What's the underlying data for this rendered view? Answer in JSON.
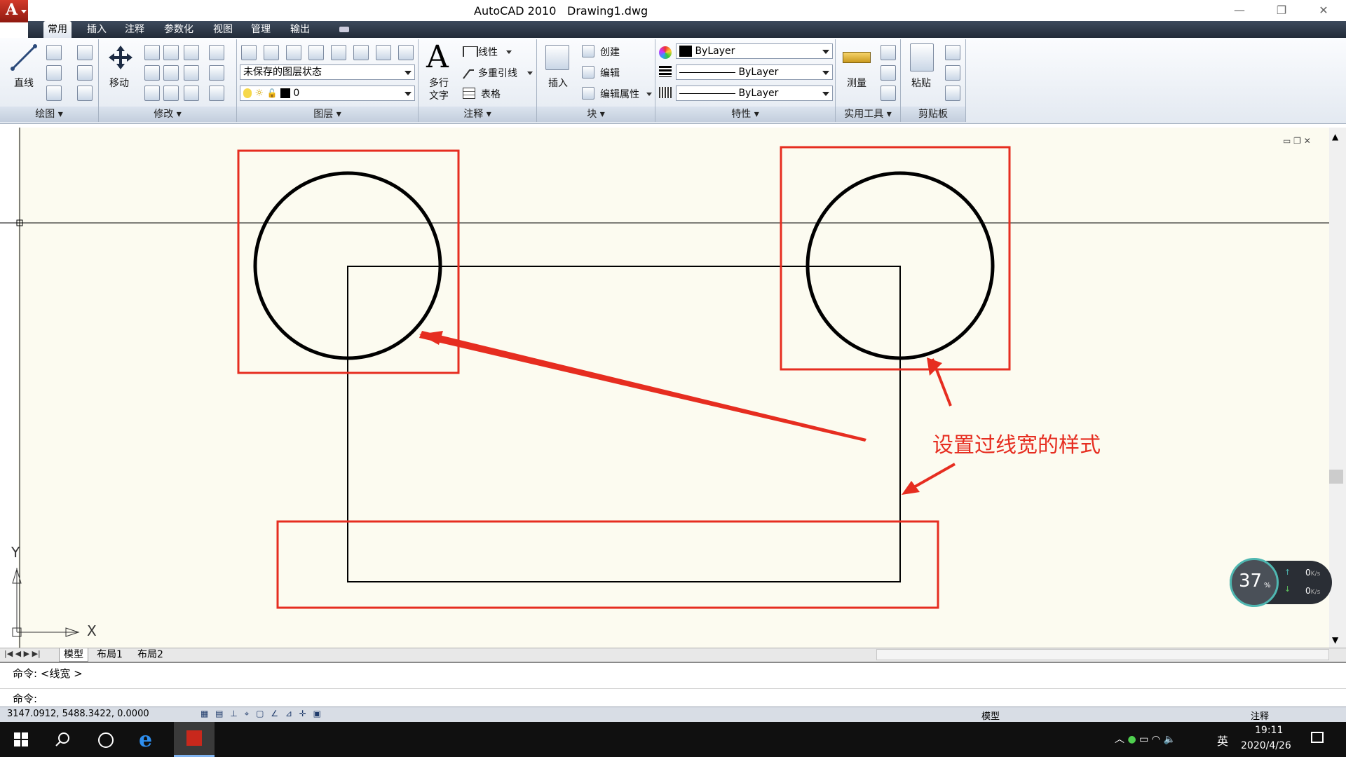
{
  "window": {
    "title": "AutoCAD 2010",
    "file": "Drawing1.dwg",
    "min": "—",
    "max": "❐",
    "close": "✕"
  },
  "app_logo": "A",
  "ribbon_tabs": [
    "常用",
    "插入",
    "注释",
    "参数化",
    "视图",
    "管理",
    "输出"
  ],
  "ribbon": {
    "draw": {
      "line_label": "直线",
      "panel": "绘图"
    },
    "modify": {
      "move_label": "移动",
      "panel": "修改"
    },
    "layers": {
      "state": "未保存的图层状态",
      "current": "0",
      "panel": "图层"
    },
    "annotation": {
      "mtext_label1": "多行",
      "mtext_label2": "文字",
      "dim_label": "线性",
      "mleader_label": "多重引线",
      "table_label": "表格",
      "panel": "注释"
    },
    "block": {
      "insert_label": "插入",
      "create_label": "创建",
      "edit_label": "编辑",
      "attr_label": "编辑属性",
      "panel": "块"
    },
    "properties": {
      "color": "ByLayer",
      "linetype": "ByLayer",
      "lineweight": "ByLayer",
      "panel": "特性"
    },
    "utilities": {
      "measure_label": "测量",
      "panel": "实用工具"
    },
    "clipboard": {
      "paste_label": "粘贴",
      "panel": "剪贴板"
    }
  },
  "annotation_text": "设置过线宽的样式",
  "ucs": {
    "x": "X",
    "y": "Y"
  },
  "layout_tabs": [
    "模型",
    "布局1",
    "布局2"
  ],
  "command": {
    "history": "命令:  <线宽 >",
    "prompt": "命令:"
  },
  "status": {
    "coords": "3147.0912,   5488.3422,  0.0000",
    "model": "模型",
    "annotate": "注释"
  },
  "net_widget": {
    "percent": "37",
    "unit": "%",
    "up": "0",
    "down": "0",
    "speed_unit": "K/s"
  },
  "taskbar": {
    "ime": "英",
    "time": "19:11",
    "date": "2020/4/26"
  },
  "colors": {
    "annotation_red": "#e62d20",
    "canvas_bg": "#fcfbf0",
    "ribbon_tab_bg": "#2e3846"
  }
}
